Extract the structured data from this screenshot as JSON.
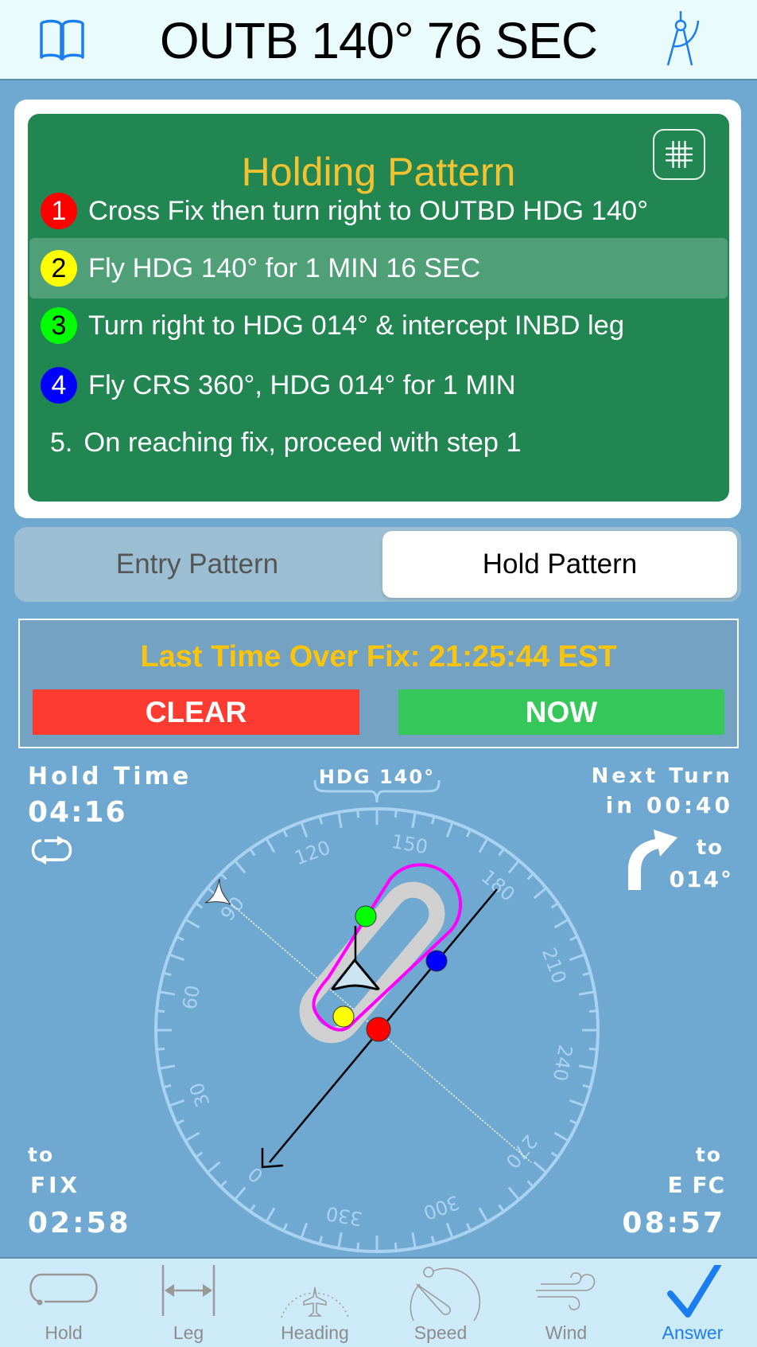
{
  "header": {
    "title": "OUTB 140°  76 SEC",
    "left_icon": "book-icon",
    "right_icon": "drafting-compass-icon"
  },
  "pattern_card": {
    "title": "Holding Pattern",
    "grid_icon": "grid-icon",
    "steps": [
      {
        "num": "1",
        "text": "Cross Fix then turn right to OUTBD HDG 140°",
        "color": "#ff0000",
        "num_color": "#ffffff",
        "active": false
      },
      {
        "num": "2",
        "text": "Fly HDG 140° for 1 MIN 16 SEC",
        "color": "#ffff00",
        "num_color": "#000000",
        "active": true
      },
      {
        "num": "3",
        "text": "Turn right to HDG 014° & intercept INBD leg",
        "color": "#00ff00",
        "num_color": "#000000",
        "active": false
      },
      {
        "num": "4",
        "text": "Fly CRS 360°, HDG 014° for 1 MIN",
        "color": "#0000ff",
        "num_color": "#ffffff",
        "active": false
      },
      {
        "num": "5.",
        "text": "On reaching fix, proceed with step 1",
        "color": null,
        "num_color": "#ffffff",
        "active": false
      }
    ]
  },
  "segmented": {
    "options": [
      "Entry Pattern",
      "Hold Pattern"
    ],
    "selected": "Hold Pattern"
  },
  "fix_timer": {
    "label": "Last Time Over Fix:  21:25:44 EST",
    "clear_label": "CLEAR",
    "now_label": "NOW"
  },
  "hold_time": {
    "label": "Hold Time",
    "value": "04:16",
    "icon": "repeat-icon"
  },
  "next_turn": {
    "label": "Next Turn",
    "value": "in 00:40",
    "to_label": "to",
    "heading": "014°",
    "icon": "turn-right-arrow-icon"
  },
  "to_fix": {
    "to": "to",
    "label": "FIX",
    "value": "02:58"
  },
  "to_efc": {
    "to": "to",
    "label": "E FC",
    "value": "08:57"
  },
  "compass": {
    "heading_label": "HDG 140°",
    "heading_deg": 140,
    "labels": [
      "0",
      "30",
      "60",
      "90",
      "120",
      "150",
      "180",
      "210",
      "240",
      "270",
      "300",
      "330"
    ],
    "inbound_course_deg": 360,
    "turn_direction": "right",
    "pattern_colors": {
      "track": "#ff00ff",
      "racetrack": "#d0d0d0"
    },
    "markers": [
      {
        "step": 1,
        "color": "#ff0000"
      },
      {
        "step": 2,
        "color": "#ffff00"
      },
      {
        "step": 3,
        "color": "#00ff00"
      },
      {
        "step": 4,
        "color": "#0000ff"
      }
    ]
  },
  "tabbar": {
    "tabs": [
      {
        "label": "Hold",
        "icon": "hold-racetrack-icon",
        "active": false
      },
      {
        "label": "Leg",
        "icon": "leg-length-icon",
        "active": false
      },
      {
        "label": "Heading",
        "icon": "heading-dial-icon",
        "active": false
      },
      {
        "label": "Speed",
        "icon": "speed-gauge-icon",
        "active": false
      },
      {
        "label": "Wind",
        "icon": "wind-icon",
        "active": false
      },
      {
        "label": "Answer",
        "icon": "checkmark-icon",
        "active": true
      }
    ]
  }
}
